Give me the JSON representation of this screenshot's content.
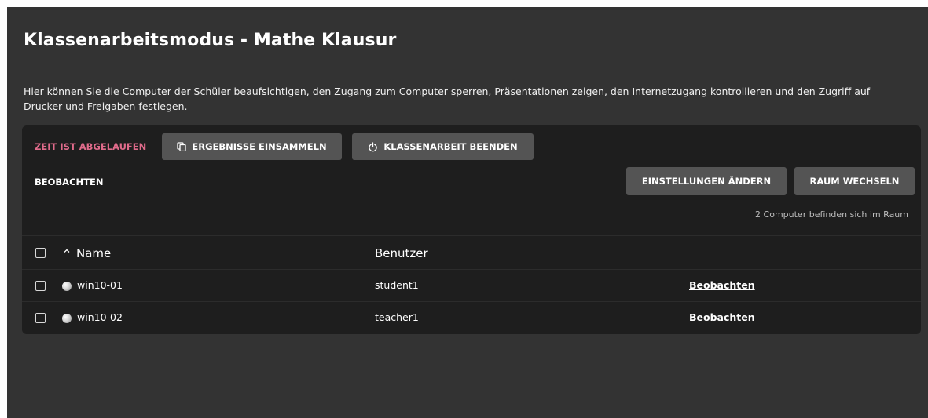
{
  "header": {
    "title": "Klassenarbeitsmodus - Mathe Klausur",
    "description": "Hier können Sie die Computer der Schüler beaufsichtigen, den Zugang zum Computer sperren, Präsentationen zeigen, den Internetzugang kontrollieren und den Zugriff auf Drucker und Freigaben festlegen."
  },
  "toolbar": {
    "timer_status": "ZEIT IST ABGELAUFEN",
    "collect_label": "ERGEBNISSE EINSAMMELN",
    "collect_icon": "copy-icon",
    "end_label": "KLASSENARBEIT BEENDEN",
    "end_icon": "power-icon"
  },
  "view": {
    "section_label": "BEOBACHTEN",
    "settings_label": "EINSTELLUNGEN ÄNDERN",
    "room_label": "RAUM WECHSELN",
    "computer_count": "2 Computer befinden sich im Raum"
  },
  "table": {
    "columns": [
      "Name",
      "Benutzer"
    ],
    "sort_icon": "chevron-up-icon",
    "rows": [
      {
        "name": "win10-01",
        "user": "student1",
        "action": "Beobachten",
        "status_icon": "status-dot-icon"
      },
      {
        "name": "win10-02",
        "user": "teacher1",
        "action": "Beobachten",
        "status_icon": "status-dot-icon"
      }
    ]
  },
  "colors": {
    "background": "#333333",
    "panel": "#1e1e1e",
    "button": "#545454",
    "alert_text": "#e06b8b"
  }
}
